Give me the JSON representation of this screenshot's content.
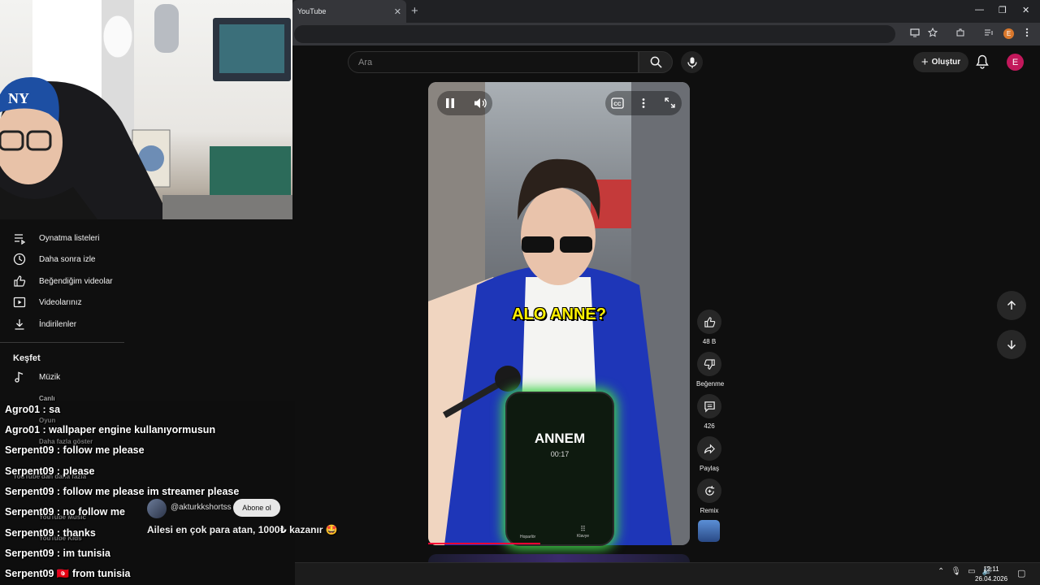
{
  "browser": {
    "tab_title": "YouTube",
    "tab_close": "✕",
    "new_tab": "+",
    "window_controls": [
      "—",
      "❐",
      "✕"
    ],
    "profile_letter": "E"
  },
  "header": {
    "search_placeholder": "Ara",
    "create_label": "Oluştur",
    "avatar_letter": "E"
  },
  "sidebar": {
    "items": [
      {
        "label": "Oynatma listeleri",
        "icon": "playlist-icon"
      },
      {
        "label": "Daha sonra izle",
        "icon": "clock-icon"
      },
      {
        "label": "Beğendiğim videolar",
        "icon": "thumbs-up-icon"
      },
      {
        "label": "Videolarınız",
        "icon": "video-icon"
      },
      {
        "label": "İndirilenler",
        "icon": "download-icon"
      }
    ],
    "explore_title": "Keşfet",
    "explore_items": [
      {
        "label": "Müzik",
        "icon": "music-note-icon"
      }
    ]
  },
  "chat": {
    "messages": [
      {
        "text": "Agro01 : sa"
      },
      {
        "text": "Agro01 : wallpaper engine kullanıyormusun"
      },
      {
        "text": "Serpent09 : follow me please"
      },
      {
        "text": "Serpent09 : please"
      },
      {
        "text": "Serpent09 : follow me please im streamer please"
      },
      {
        "text": "Serpent09 : no follow me"
      },
      {
        "text": "Serpent09 : thanks"
      },
      {
        "text": "Serpent09 : im tunisia"
      },
      {
        "text": "Serpent09 🇹🇳 from tunisia"
      }
    ],
    "faded_sidebar_text": [
      "Canlı",
      "Oyun",
      "Daha fazla göster",
      "YouTube'dan daha fazla",
      "YouTube Music",
      "YouTube Kids"
    ]
  },
  "short": {
    "caption": "ALO ANNE?",
    "call_name": "ANNEM",
    "call_time": "00:17",
    "phone_speaker_label": "Hoparlör",
    "phone_keypad_label": "Klavye",
    "progress": 0.43,
    "channel_handle": "@akturkkshortss",
    "subscribe_label": "Abone ol",
    "title": "Ailesi en çok para atan, 1000₺ kazanır 🤩"
  },
  "actions": {
    "like_count": "48 B",
    "dislike_label": "Beğenme",
    "comment_count": "426",
    "share_label": "Paylaş",
    "remix_label": "Remix"
  },
  "taskbar": {
    "time": "12:11",
    "date": "26.04.2026"
  }
}
